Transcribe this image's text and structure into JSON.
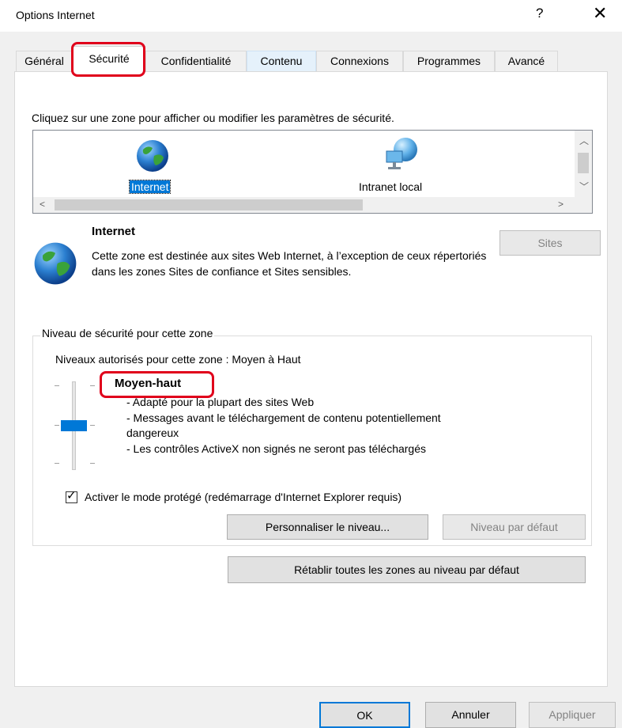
{
  "window": {
    "title": "Options Internet",
    "help_glyph": "?",
    "close_glyph": "✕"
  },
  "tabs": [
    {
      "label": "Général"
    },
    {
      "label": "Sécurité"
    },
    {
      "label": "Confidentialité"
    },
    {
      "label": "Contenu"
    },
    {
      "label": "Connexions"
    },
    {
      "label": "Programmes"
    },
    {
      "label": "Avancé"
    }
  ],
  "instruction": "Cliquez sur une zone pour afficher ou modifier les paramètres de sécurité.",
  "zones": [
    {
      "label": "Internet",
      "icon": "globe-icon",
      "selected": true
    },
    {
      "label": "Intranet local",
      "icon": "network-globe-icon",
      "selected": false
    }
  ],
  "zone_info": {
    "title": "Internet",
    "description": "Cette zone est destinée aux sites Web Internet, à l’exception de ceux répertoriés dans les zones Sites de confiance et Sites sensibles.",
    "sites_button": "Sites"
  },
  "security_level": {
    "group_label": "Niveau de sécurité pour cette zone",
    "allowed_levels": "Niveaux autorisés pour cette zone : Moyen à Haut",
    "level_name": "Moyen-haut",
    "level_details": [
      "- Adapté pour la plupart des sites Web",
      "- Messages avant le téléchargement de contenu potentiellement",
      "dangereux",
      "- Les contrôles ActiveX non signés ne seront pas téléchargés"
    ],
    "protected_mode_label": "Activer le mode protégé (redémarrage d'Internet Explorer requis)",
    "protected_mode_checked": true,
    "custom_level_button": "Personnaliser le niveau...",
    "default_level_button": "Niveau par défaut"
  },
  "reset_all_button": "Rétablir toutes les zones au niveau par défaut",
  "footer": {
    "ok": "OK",
    "cancel": "Annuler",
    "apply": "Appliquer"
  },
  "colors": {
    "accent": "#0078d7",
    "highlight": "#e0001b"
  }
}
